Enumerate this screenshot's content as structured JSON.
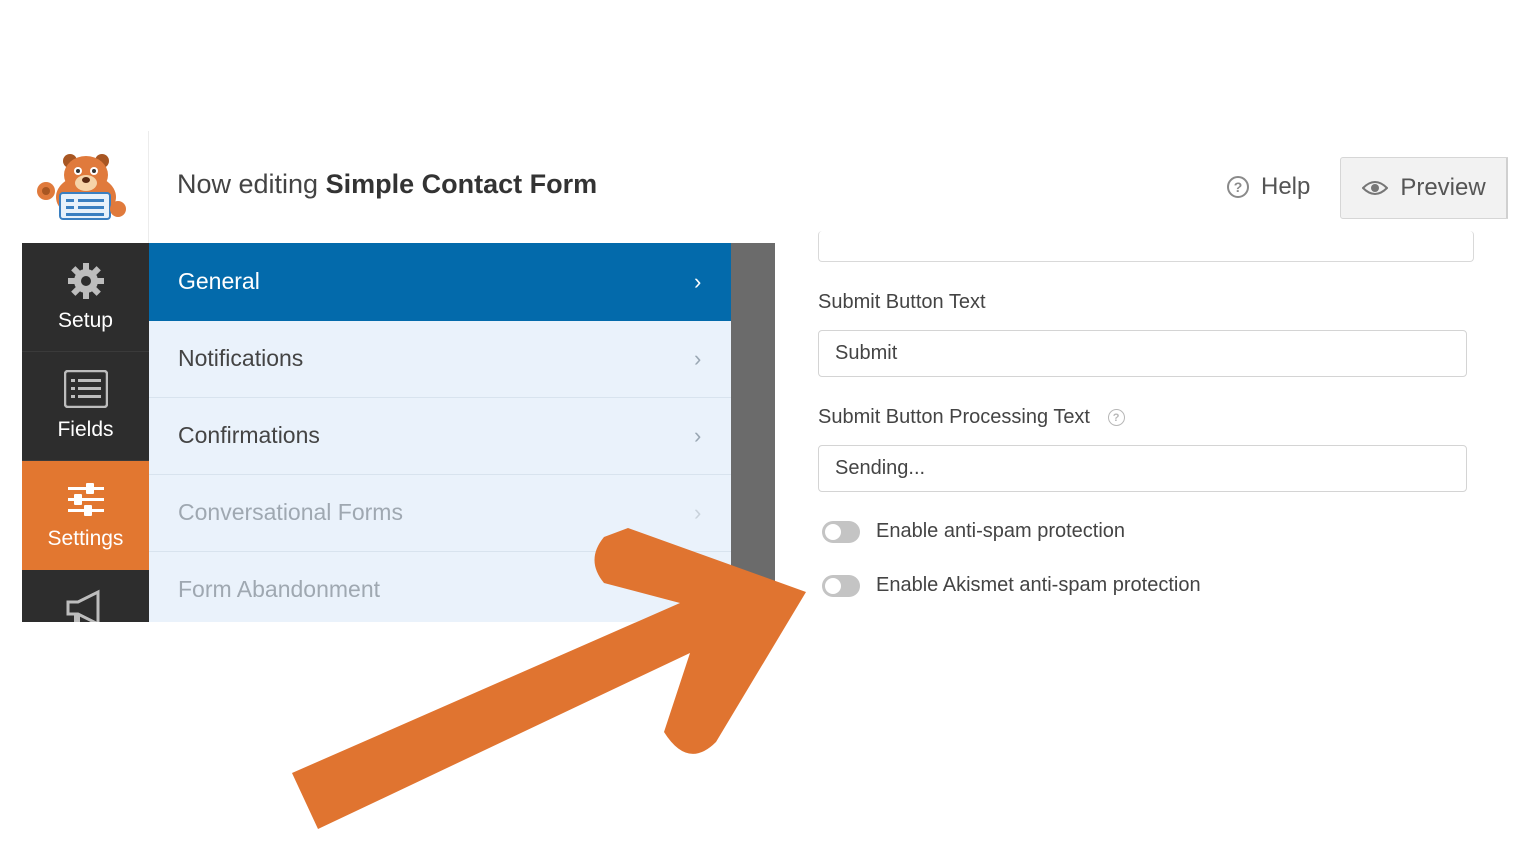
{
  "header": {
    "title_prefix": "Now editing",
    "form_name": "Simple Contact Form",
    "help_label": "Help",
    "preview_label": "Preview"
  },
  "leftnav": {
    "items": [
      {
        "label": "Setup",
        "icon": "gear-icon"
      },
      {
        "label": "Fields",
        "icon": "fields-icon"
      },
      {
        "label": "Settings",
        "icon": "sliders-icon",
        "active": true
      },
      {
        "label": "",
        "icon": "megaphone-icon"
      }
    ]
  },
  "settings_panel": {
    "items": [
      {
        "label": "General",
        "active": true
      },
      {
        "label": "Notifications"
      },
      {
        "label": "Confirmations"
      },
      {
        "label": "Conversational Forms",
        "disabled": true
      },
      {
        "label": "Form Abandonment",
        "disabled": true
      }
    ]
  },
  "general": {
    "submit_text_label": "Submit Button Text",
    "submit_text_value": "Submit",
    "processing_label": "Submit Button Processing Text",
    "processing_value": "Sending...",
    "antispam_label": "Enable anti-spam protection",
    "antispam_enabled": false,
    "akismet_label": "Enable Akismet anti-spam protection",
    "akismet_enabled": false
  },
  "colors": {
    "accent_orange": "#e27730",
    "active_blue": "#036aab",
    "nav_dark": "#2d2d2d",
    "panel_bg": "#eaf2fb"
  }
}
